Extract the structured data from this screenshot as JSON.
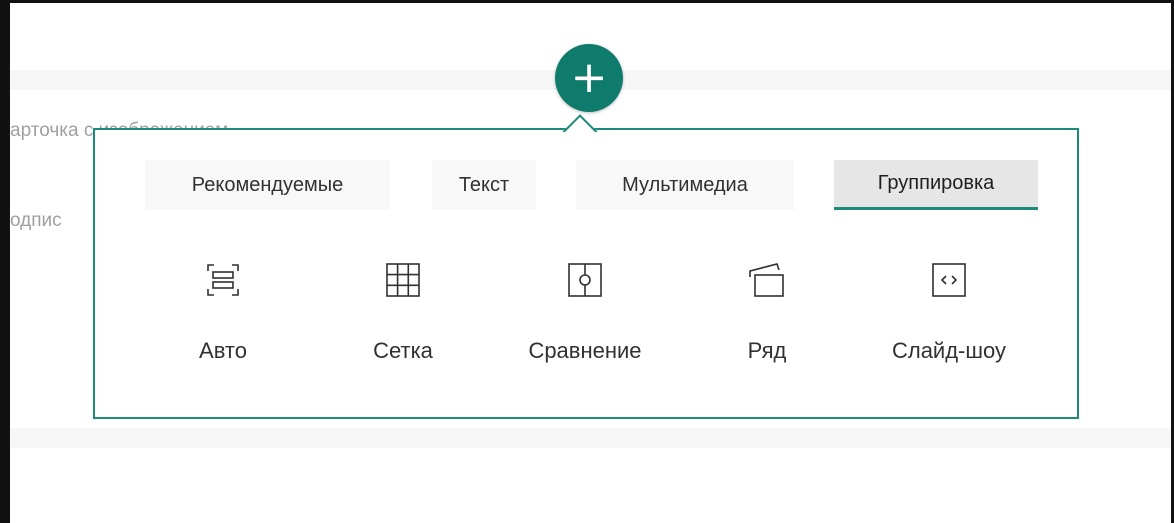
{
  "background": {
    "text_1": "арточка с изображением",
    "text_2": "одпис"
  },
  "add_button": {
    "icon": "plus-icon",
    "glyph": "+",
    "color": "#0f7b6c"
  },
  "toolbox": {
    "accent_color": "#1d8b7a",
    "tabs": [
      {
        "label": "Рекомендуемые",
        "selected": false
      },
      {
        "label": "Текст",
        "selected": false
      },
      {
        "label": "Мультимедиа",
        "selected": false
      },
      {
        "label": "Группировка",
        "selected": true
      }
    ],
    "options": [
      {
        "label": "Авто",
        "icon": "auto-layout-icon"
      },
      {
        "label": "Сетка",
        "icon": "grid-icon"
      },
      {
        "label": "Сравнение",
        "icon": "comparison-icon"
      },
      {
        "label": "Ряд",
        "icon": "row-icon"
      },
      {
        "label": "Слайд-шоу",
        "icon": "slideshow-icon"
      }
    ]
  }
}
